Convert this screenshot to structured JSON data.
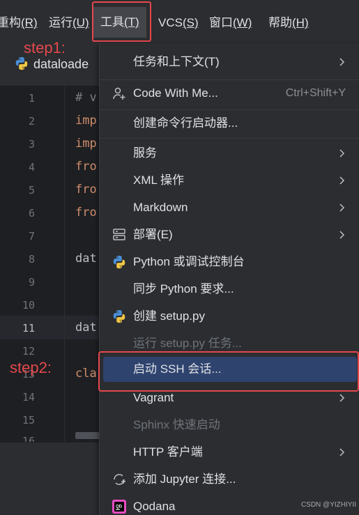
{
  "menubar": {
    "items": [
      {
        "label": "重构",
        "mnemonic": "(R)"
      },
      {
        "label": "运行",
        "mnemonic": "(U)"
      },
      {
        "label": "工具",
        "mnemonic": "(T)"
      },
      {
        "label": "VCS",
        "mnemonic": "(S)"
      },
      {
        "label": "窗口",
        "mnemonic": "(W)"
      },
      {
        "label": "帮助",
        "mnemonic": "(H)"
      }
    ]
  },
  "annotations": {
    "step1": "step1:",
    "step2": "step2:"
  },
  "editor": {
    "tab_label": "dataloade",
    "line_numbers": [
      "1",
      "2",
      "3",
      "4",
      "5",
      "6",
      "7",
      "8",
      "9",
      "10",
      "11",
      "12",
      "13",
      "14",
      "15",
      "16"
    ],
    "code_fragments": [
      "# v",
      "imp",
      "imp",
      "fro",
      "fro",
      "fro",
      "dat",
      "dat",
      "cla"
    ]
  },
  "dropdown": {
    "items": [
      {
        "label": "任务和上下文(T)",
        "submenu": true
      },
      {
        "label": "Code With Me...",
        "shortcut": "Ctrl+Shift+Y",
        "icon": "add-user-icon"
      },
      {
        "label": "创建命令行启动器..."
      },
      {
        "label": "服务",
        "submenu": true
      },
      {
        "label": "XML 操作",
        "submenu": true
      },
      {
        "label": "Markdown",
        "submenu": true
      },
      {
        "label": "部署(E)",
        "submenu": true,
        "icon": "deployment-icon"
      },
      {
        "label": "Python 或调试控制台",
        "icon": "python-icon"
      },
      {
        "label": "同步 Python 要求..."
      },
      {
        "label": "创建 setup.py",
        "icon": "python-icon"
      },
      {
        "label": "运行 setup.py 任务...",
        "disabled": true
      },
      {
        "label": "启动 SSH 会话...",
        "selected": true
      },
      {
        "label": "Vagrant",
        "submenu": true
      },
      {
        "label": "Sphinx 快速启动",
        "disabled": true
      },
      {
        "label": "HTTP 客户端",
        "submenu": true
      },
      {
        "label": "添加 Jupyter 连接...",
        "icon": "jupyter-icon"
      },
      {
        "label": "Qodana",
        "icon": "qodana-icon"
      }
    ]
  },
  "watermark": "CSDN @YIZHIYII",
  "colors": {
    "accent_red": "#e5484d",
    "selection": "#2e436e",
    "background": "#2b2d30"
  }
}
